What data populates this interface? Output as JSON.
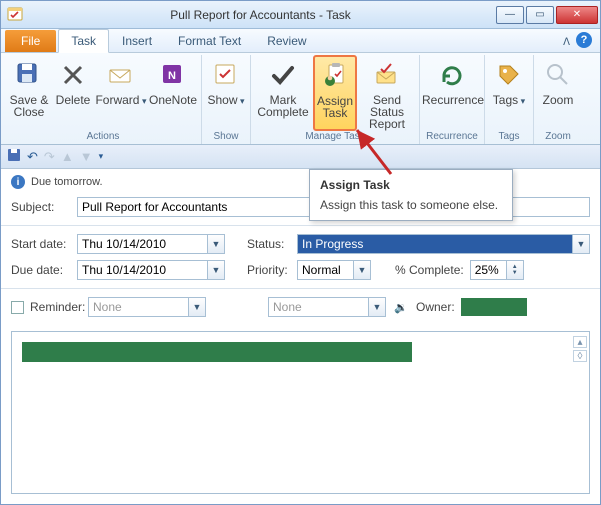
{
  "title": "Pull Report for Accountants  -  Task",
  "tabs": {
    "file": "File",
    "task": "Task",
    "insert": "Insert",
    "format": "Format Text",
    "review": "Review"
  },
  "ribbon": {
    "actions": {
      "label": "Actions",
      "save_close": "Save & Close",
      "delete": "Delete",
      "forward": "Forward",
      "onenote": "OneNote"
    },
    "show": {
      "label": "Show",
      "show": "Show"
    },
    "manage": {
      "label": "Manage Task",
      "mark_complete": "Mark Complete",
      "assign_task": "Assign Task",
      "send_status": "Send Status Report"
    },
    "recurrence": {
      "label": "Recurrence",
      "recurrence": "Recurrence"
    },
    "tags": {
      "label": "Tags",
      "tags": "Tags"
    },
    "zoom": {
      "label": "Zoom",
      "zoom": "Zoom"
    }
  },
  "info": {
    "due": "Due tomorrow."
  },
  "labels": {
    "subject": "Subject:",
    "start": "Start date:",
    "due": "Due date:",
    "status": "Status:",
    "priority": "Priority:",
    "pct": "% Complete:",
    "reminder": "Reminder:",
    "owner": "Owner:"
  },
  "fields": {
    "subject": "Pull Report for Accountants",
    "start_date": "Thu 10/14/2010",
    "due_date": "Thu 10/14/2010",
    "status": "In Progress",
    "priority": "Normal",
    "pct_complete": "25%",
    "reminder_date": "None",
    "reminder_time": "None"
  },
  "tooltip": {
    "title": "Assign Task",
    "body": "Assign this task to someone else."
  }
}
